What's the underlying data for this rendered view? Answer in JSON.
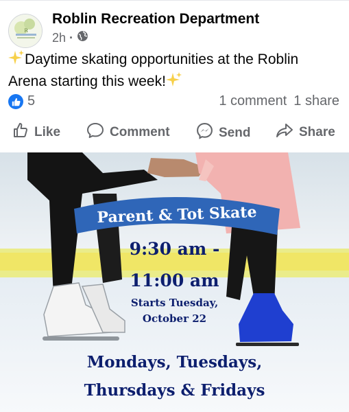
{
  "post": {
    "page_name": "Roblin Recreation Department",
    "time": "2h",
    "audience_icon": "globe-icon",
    "text_line1": "Daytime skating opportunities at the Roblin",
    "text_line2": "Arena starting this week!",
    "sparkle_icon": "sparkles-icon"
  },
  "stats": {
    "reaction_icon": "like-icon",
    "reaction_count": "5",
    "comments": "1 comment",
    "shares": "1 share"
  },
  "actions": {
    "like": "Like",
    "comment": "Comment",
    "send": "Send",
    "share": "Share"
  },
  "graphic": {
    "title": "Parent & Tot Skate",
    "time_line1": "9:30 am -",
    "time_line2": "11:00 am",
    "start_line1": "Starts Tuesday,",
    "start_line2": "October 22",
    "days_line1": "Mondays, Tuesdays,",
    "days_line2": "Thursdays & Fridays"
  },
  "colors": {
    "facebook_blue": "#1877f2",
    "banner_blue": "#2f66b8",
    "graphic_text_navy": "#0d1f6e",
    "meta_gray": "#65676b",
    "board_yellow": "#f2e45a"
  }
}
